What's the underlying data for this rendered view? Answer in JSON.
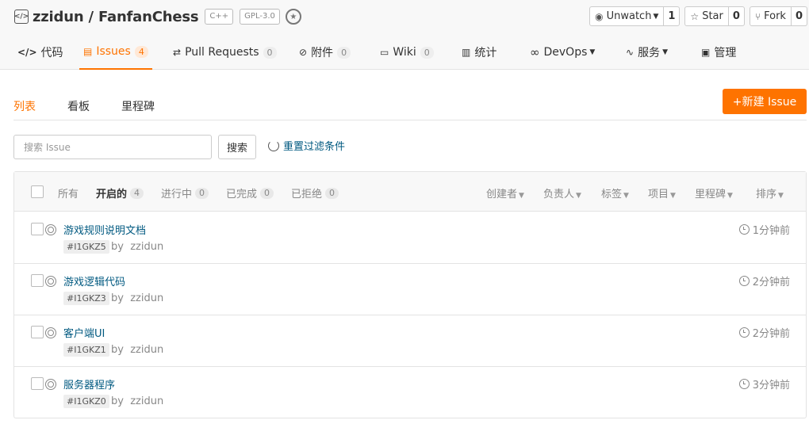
{
  "repo": {
    "owner": "zzidun",
    "name": "FanfanChess",
    "separator": " / ",
    "tags": [
      "C++",
      "GPL-3.0"
    ],
    "unwatch": {
      "label": "Unwatch",
      "count": "1"
    },
    "star": {
      "label": "Star",
      "count": "0"
    },
    "fork": {
      "label": "Fork",
      "count": "0"
    }
  },
  "tabs": [
    {
      "label": "代码"
    },
    {
      "label": "Issues",
      "count": "4"
    },
    {
      "label": "Pull Requests",
      "count": "0"
    },
    {
      "label": "附件",
      "count": "0"
    },
    {
      "label": "Wiki",
      "count": "0"
    },
    {
      "label": "统计"
    },
    {
      "label": "DevOps"
    },
    {
      "label": "服务"
    },
    {
      "label": "管理"
    }
  ],
  "subnav": {
    "list": "列表",
    "board": "看板",
    "milestone": "里程碑",
    "new_issue": "+新建 Issue"
  },
  "search": {
    "placeholder": "搜索 Issue",
    "button": "搜索",
    "reset": "重置过滤条件"
  },
  "filters": {
    "states": [
      {
        "label": "所有"
      },
      {
        "label": "开启的",
        "count": "4"
      },
      {
        "label": "进行中",
        "count": "0"
      },
      {
        "label": "已完成",
        "count": "0"
      },
      {
        "label": "已拒绝",
        "count": "0"
      }
    ],
    "dropdowns": [
      "创建者",
      "负责人",
      "标签",
      "项目",
      "里程碑",
      "排序"
    ]
  },
  "issues": [
    {
      "title": "游戏规则说明文档",
      "id": "#I1GKZ5",
      "by": "by",
      "author": "zzidun",
      "time": "1分钟前"
    },
    {
      "title": "游戏逻辑代码",
      "id": "#I1GKZ3",
      "by": "by",
      "author": "zzidun",
      "time": "2分钟前"
    },
    {
      "title": "客户端UI",
      "id": "#I1GKZ1",
      "by": "by",
      "author": "zzidun",
      "time": "2分钟前"
    },
    {
      "title": "服务器程序",
      "id": "#I1GKZ0",
      "by": "by",
      "author": "zzidun",
      "time": "3分钟前"
    }
  ]
}
